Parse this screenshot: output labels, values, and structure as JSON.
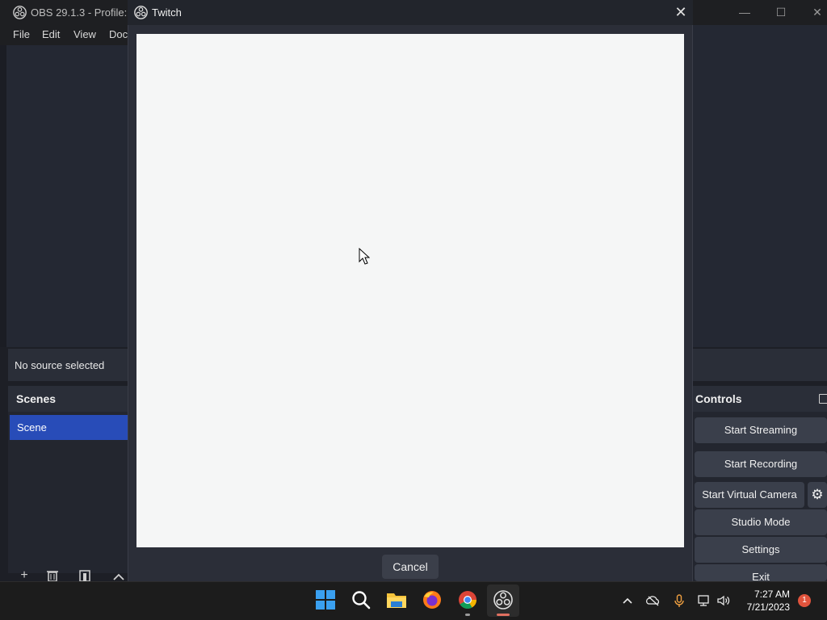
{
  "obs": {
    "title": "OBS 29.1.3 - Profile: Ur",
    "menu": [
      "File",
      "Edit",
      "View",
      "Doc"
    ],
    "window_controls": {
      "minimize": "—",
      "maximize": "☐",
      "close": "✕"
    },
    "source_status": "No source selected",
    "scenes": {
      "title": "Scenes",
      "items": [
        "Scene"
      ],
      "tools": [
        "add-icon",
        "trash-icon",
        "filter-icon",
        "chevron-up-icon"
      ]
    },
    "controls": {
      "title": "Controls",
      "buttons": [
        "Start Streaming",
        "Start Recording",
        "Start Virtual Camera",
        "Studio Mode",
        "Settings",
        "Exit"
      ]
    }
  },
  "dialog": {
    "title": "Twitch",
    "close_label": "✕",
    "cancel_label": "Cancel"
  },
  "taskbar": {
    "apps": [
      "windows-start-icon",
      "search-icon",
      "file-explorer-icon",
      "firefox-icon",
      "chrome-icon",
      "obs-icon"
    ],
    "time": "7:27 AM",
    "date": "7/21/2023",
    "notifications": "1"
  },
  "colors": {
    "accent": "#284cb8",
    "notification": "#e0533c",
    "webview_bg": "#f5f6f6"
  }
}
